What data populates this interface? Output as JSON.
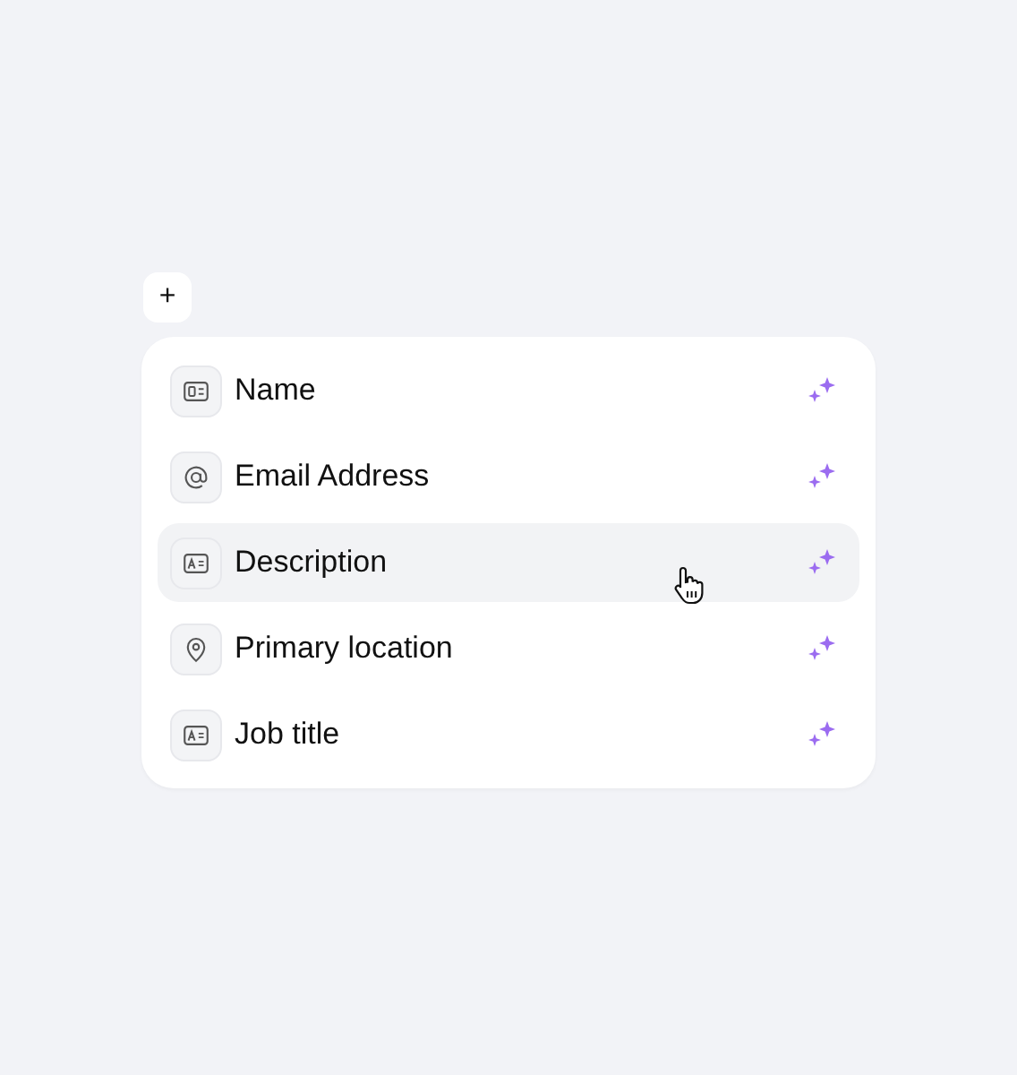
{
  "add_button": {
    "label": "+"
  },
  "fields": [
    {
      "kind": "id-card",
      "label": "Name",
      "highlighted": false
    },
    {
      "kind": "at",
      "label": "Email Address",
      "highlighted": false
    },
    {
      "kind": "text-box",
      "label": "Description",
      "highlighted": true
    },
    {
      "kind": "pin",
      "label": "Primary location",
      "highlighted": false
    },
    {
      "kind": "text-box",
      "label": "Job title",
      "highlighted": false
    }
  ]
}
